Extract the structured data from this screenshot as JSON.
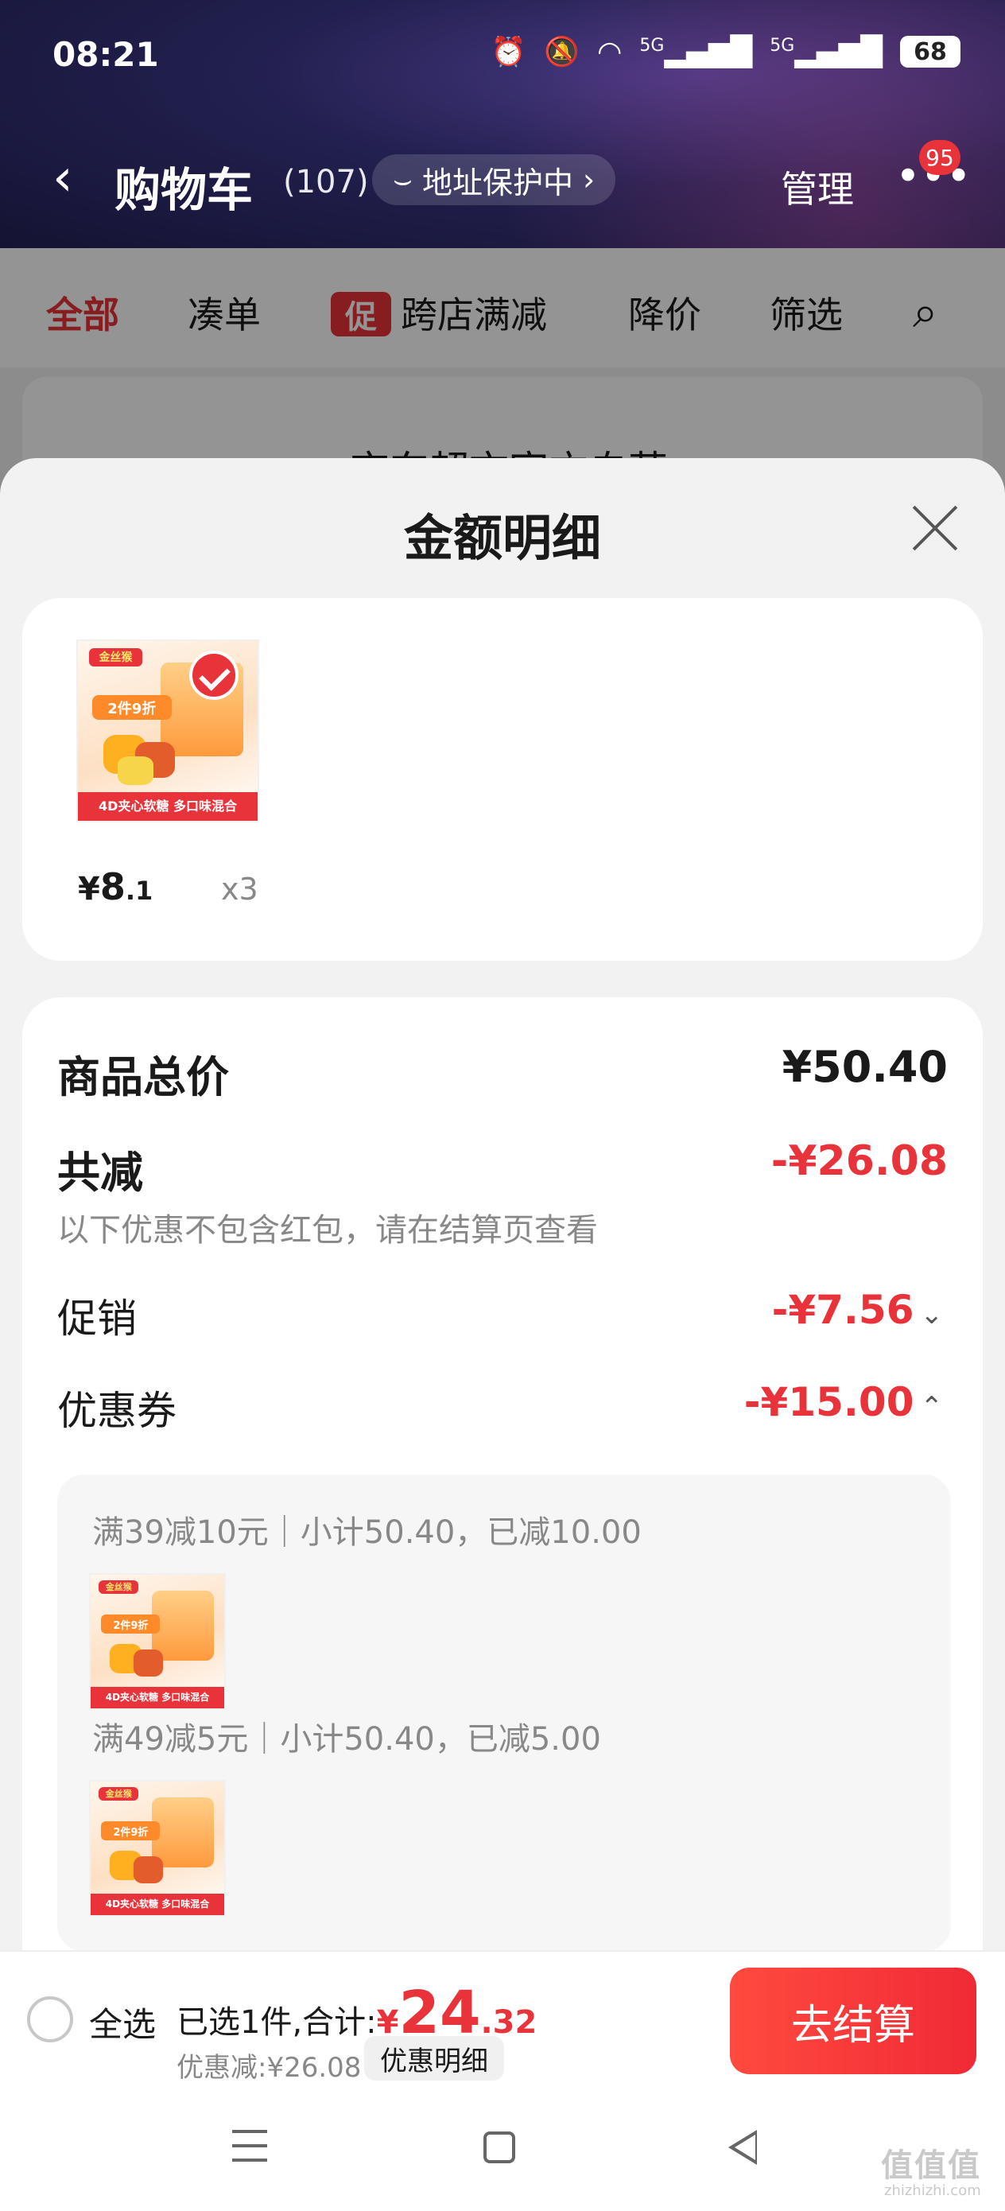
{
  "status_bar": {
    "time": "08:21",
    "battery": "68",
    "signal1": "5G",
    "signal2": "5G"
  },
  "nav": {
    "title": "购物车",
    "count": "(107)",
    "address_protect": "地址保护中",
    "manage": "管理",
    "badge": "95"
  },
  "tabs": [
    {
      "label": "全部"
    },
    {
      "label": "凑单"
    },
    {
      "label": "跨店满减",
      "tag": "促"
    },
    {
      "label": "降价"
    },
    {
      "label": "筛选"
    }
  ],
  "behind_store": "京东超市官方自营",
  "sheet": {
    "title": "金额明细",
    "item": {
      "price_symbol": "¥",
      "price_int": "8",
      "price_dec": ".1",
      "quantity": "x3",
      "thumb_band": "4D夹心软糖 多口味混合",
      "thumb_logo": "金丝猴",
      "thumb_promo": "2件9折"
    },
    "total_label": "商品总价",
    "total_value": "¥50.40",
    "reduce_label": "共减",
    "reduce_value": "-¥26.08",
    "reduce_note": "以下优惠不包含红包，请在结算页查看",
    "promo_label": "促销",
    "promo_value": "-¥7.56",
    "coupon_label": "优惠券",
    "coupon_value": "-¥15.00",
    "coupons": [
      {
        "text": "满39减10元｜小计50.40，已减10.00"
      },
      {
        "text": "满49减5元｜小计50.40，已减5.00"
      }
    ]
  },
  "bottom": {
    "select_all": "全选",
    "selected_text": "已选1件,合计:",
    "total_symbol": "¥",
    "total_int": "24",
    "total_dec": ".32",
    "discount": "优惠减:¥26.08",
    "detail_btn": "优惠明细",
    "checkout": "去结算"
  },
  "watermark": "值值值",
  "watermark_sub": "zhizhizhi.com",
  "colors": {
    "accent": "#e8333a",
    "header": "#22204f"
  }
}
